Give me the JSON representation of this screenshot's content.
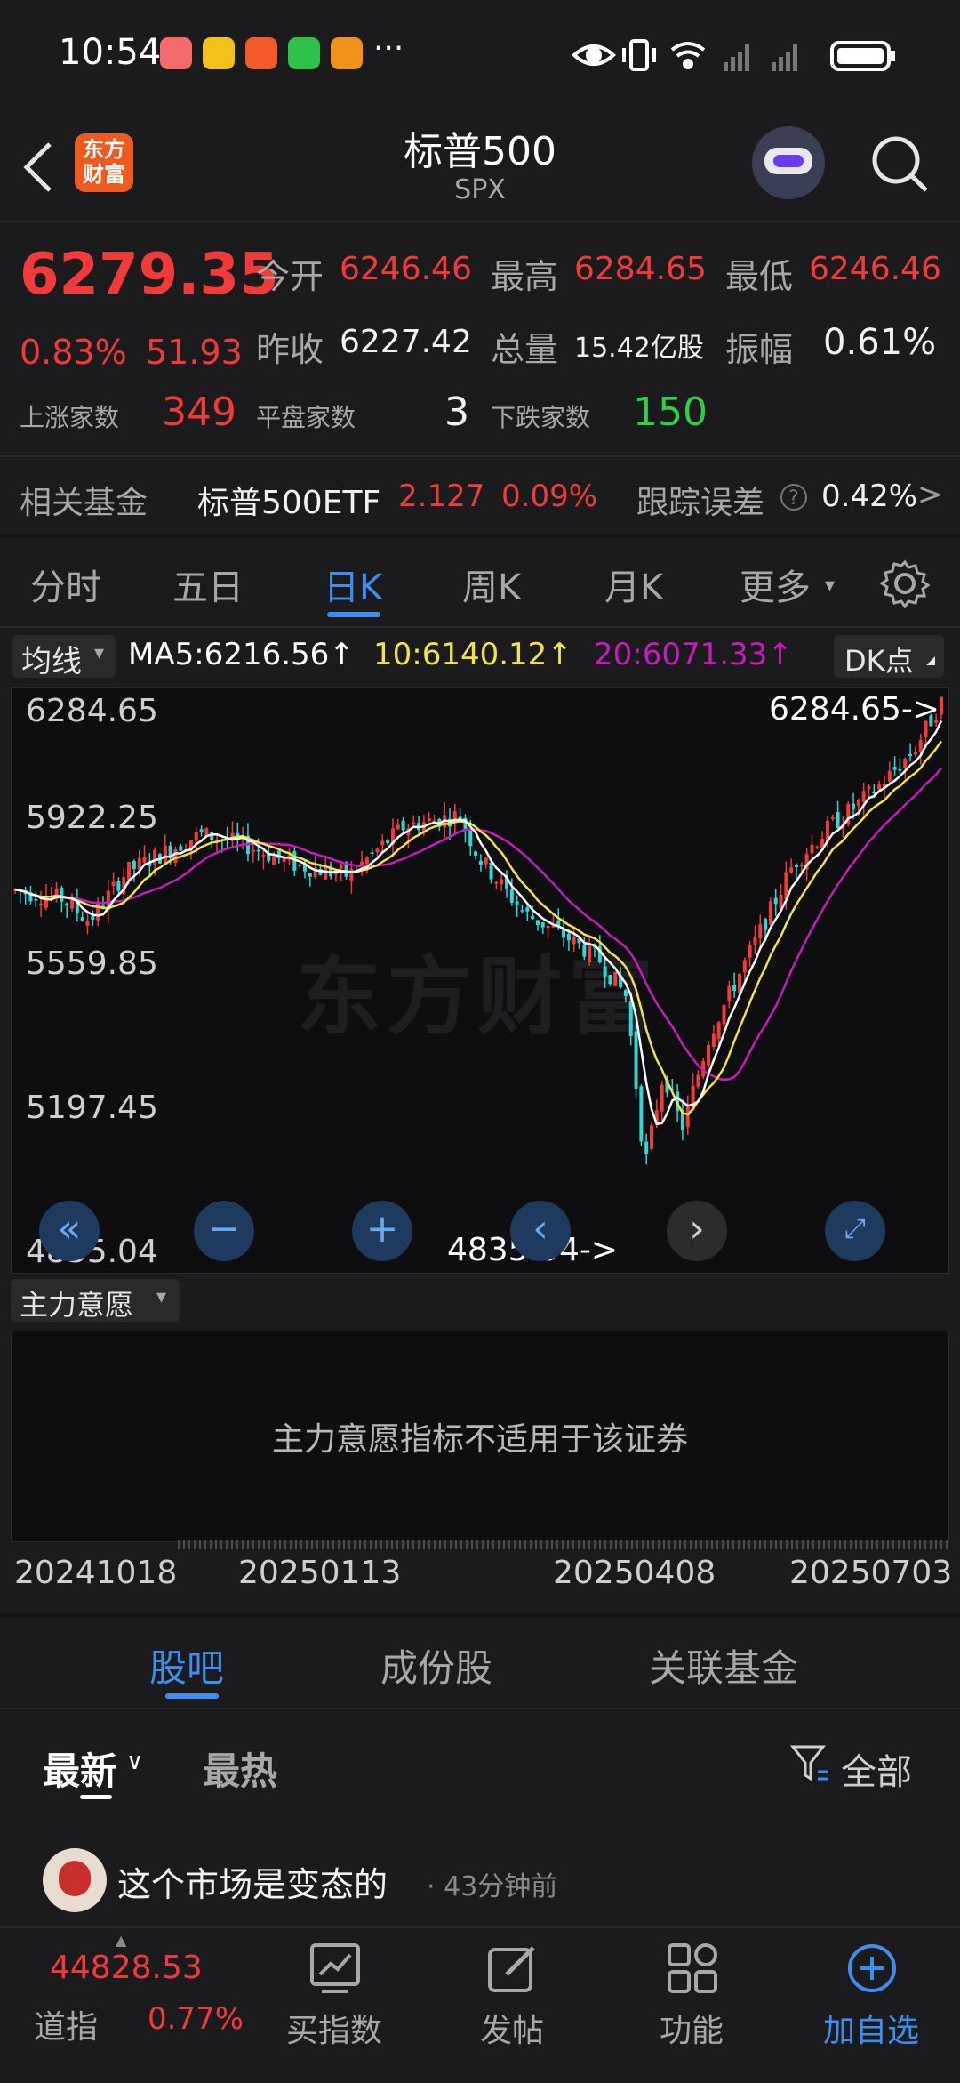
{
  "status_bar": {
    "time": "10:54",
    "more": "···"
  },
  "header": {
    "title": "标普500",
    "subtitle": "SPX",
    "logo_text": "东方财富"
  },
  "quote": {
    "price": "6279.35",
    "change_pct": "0.83%",
    "change": "51.93",
    "open_label": "今开",
    "open": "6246.46",
    "high_label": "最高",
    "high": "6284.65",
    "low_label": "最低",
    "low": "6246.46",
    "prev_close_label": "昨收",
    "prev_close": "6227.42",
    "volume_label": "总量",
    "volume": "15.42亿股",
    "amplitude_label": "振幅",
    "amplitude": "0.61%",
    "up_label": "上涨家数",
    "up": "349",
    "flat_label": "平盘家数",
    "flat": "3",
    "down_label": "下跌家数",
    "down": "150"
  },
  "fund": {
    "label": "相关基金",
    "name": "标普500ETF",
    "price": "2.127",
    "pct": "0.09%",
    "tracking_label": "跟踪误差",
    "tracking": "0.42%",
    "arrow": ">"
  },
  "ktabs": [
    "分时",
    "五日",
    "日K",
    "周K",
    "月K",
    "更多"
  ],
  "chart": {
    "ma_selector": "均线",
    "ma5": "MA5:6216.56↑",
    "ma10": "10:6140.12↑",
    "ma20": "20:6071.33↑",
    "dk_button": "DK点",
    "y_labels": [
      "6284.65",
      "5922.25",
      "5559.85",
      "5197.45",
      "4835.04"
    ],
    "max_marker": "6284.65->",
    "min_marker": "4835.04->",
    "watermark": "东方财富",
    "indicator_selector": "主力意愿",
    "indicator_msg": "主力意愿指标不适用于该证券",
    "x_labels": [
      "20241018",
      "20250113",
      "20250408",
      "20250703"
    ],
    "colors": {
      "up": "#f23a3a",
      "down": "#31d6d6",
      "ma5": "#ffffff",
      "ma10": "#f2e34a",
      "ma20": "#c71bbd"
    }
  },
  "section_tabs": [
    "股吧",
    "成份股",
    "关联基金"
  ],
  "feed": {
    "sort_new": "最新",
    "sort_hot": "最热",
    "filter": "全部",
    "post_title": "这个市场是变态的",
    "post_time": "· 43分钟前"
  },
  "bottom_nav": {
    "index_value": "44828.53",
    "index_name": "道指",
    "index_pct": "0.77%",
    "items": [
      "买指数",
      "发帖",
      "功能",
      "加自选"
    ]
  }
}
